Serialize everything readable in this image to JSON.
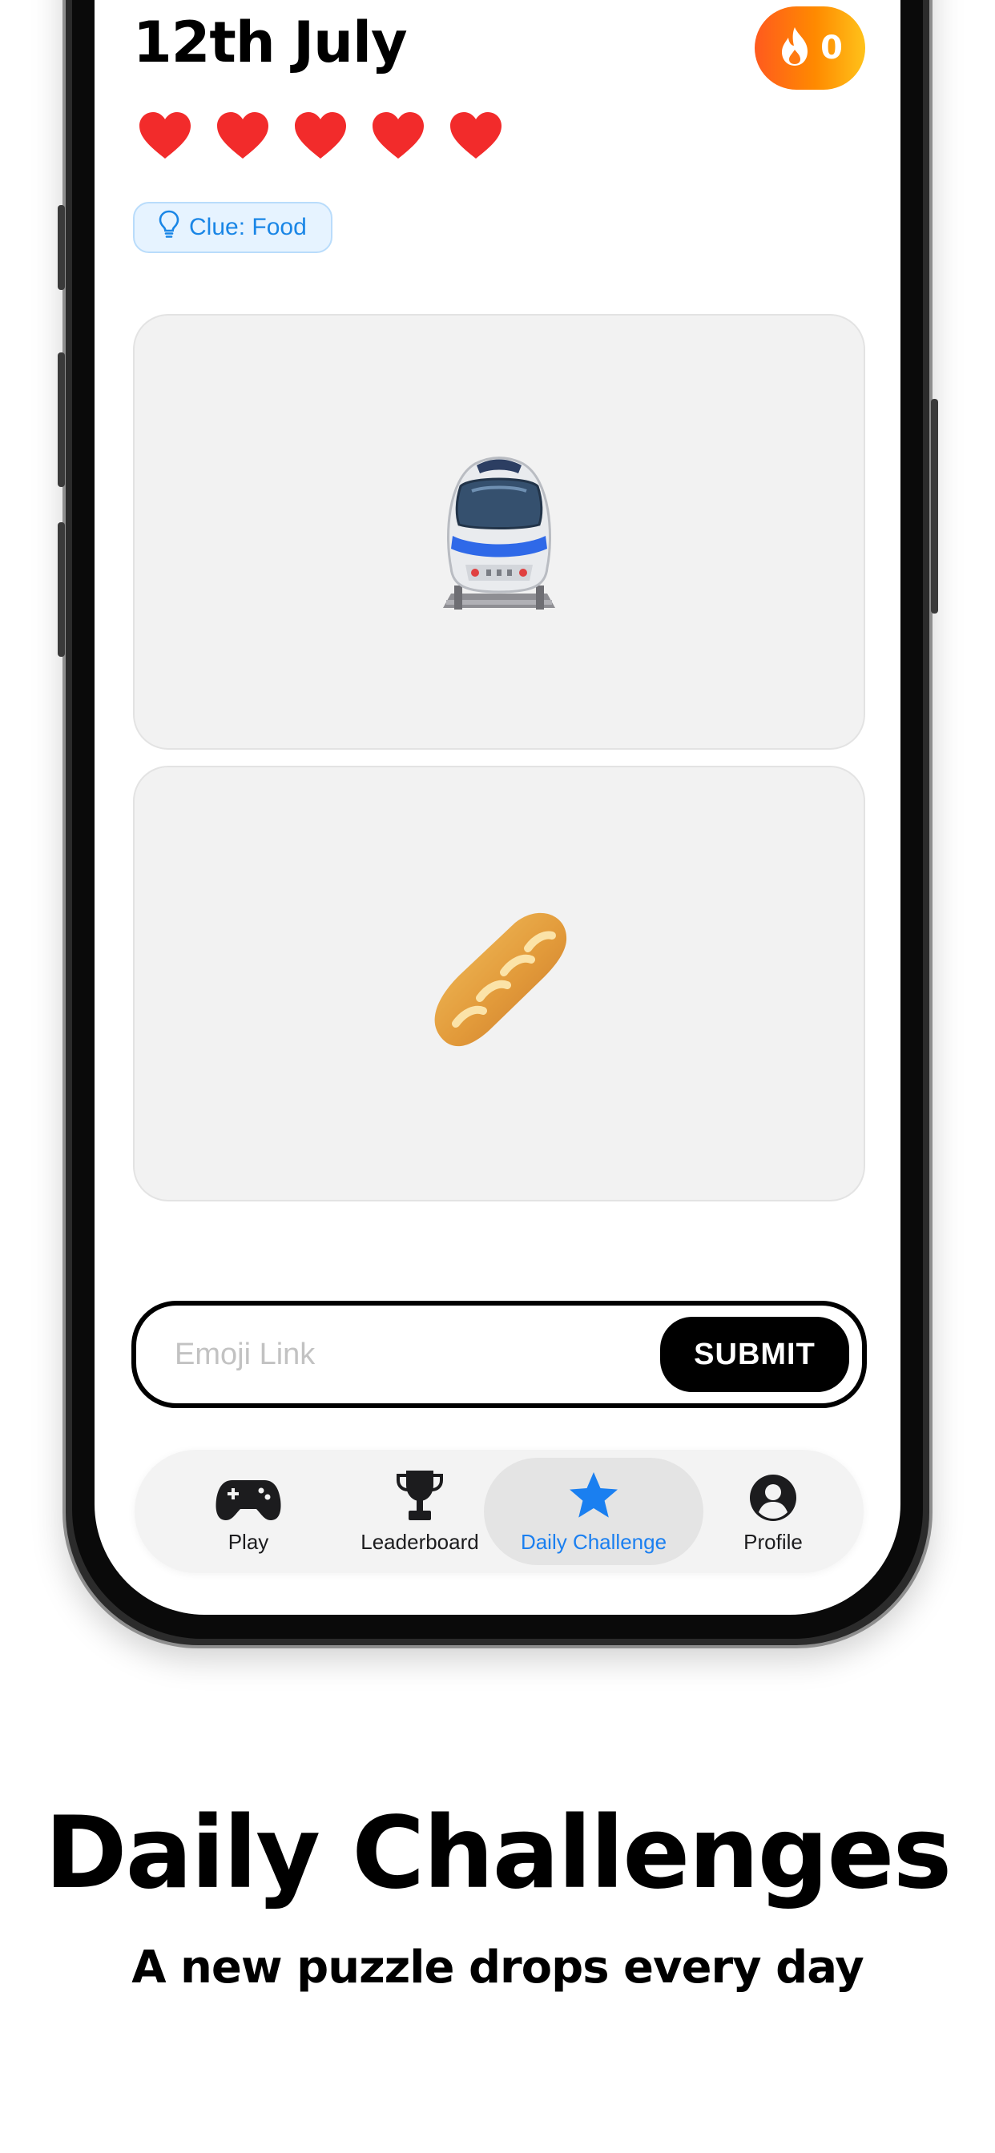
{
  "header": {
    "date_title": "12th July",
    "streak_count": "0",
    "hearts_count": 5,
    "heart_color": "#f22b2b"
  },
  "clue": {
    "label": "Clue: Food"
  },
  "puzzle": {
    "emojis": [
      {
        "name": "train-emoji"
      },
      {
        "name": "baguette-emoji"
      }
    ]
  },
  "answer": {
    "placeholder": "Emoji Link",
    "submit_label": "SUBMIT"
  },
  "tabs": [
    {
      "label": "Play",
      "icon": "gamepad-icon",
      "active": false
    },
    {
      "label": "Leaderboard",
      "icon": "trophy-icon",
      "active": false
    },
    {
      "label": "Daily Challenge",
      "icon": "star-icon",
      "active": true
    },
    {
      "label": "Profile",
      "icon": "person-circle-icon",
      "active": false
    }
  ],
  "colors": {
    "accent": "#1a7ff0",
    "streak_gradient_start": "#ff5a1e",
    "streak_gradient_end": "#ffc21a",
    "clue_bg": "#e6f3ff"
  },
  "marketing": {
    "headline": "Daily Challenges",
    "subline": "A new puzzle drops every day"
  }
}
